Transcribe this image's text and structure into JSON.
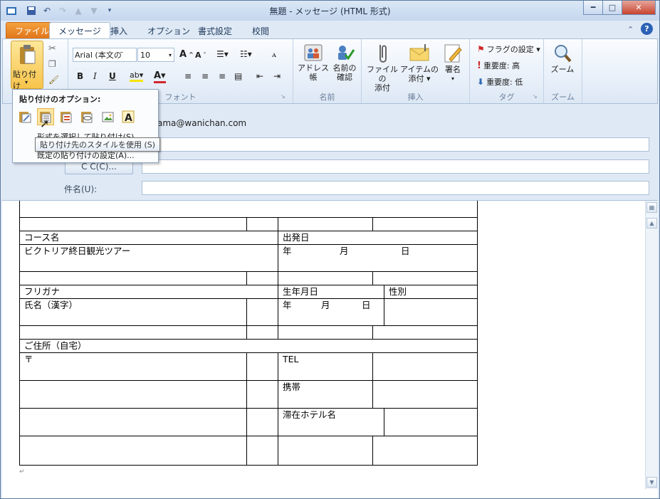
{
  "window": {
    "title": "無題 - メッセージ (HTML 形式)"
  },
  "tabs": [
    "ファイル",
    "メッセージ",
    "挿入",
    "オプション",
    "書式設定",
    "校閲"
  ],
  "ribbon": {
    "paste_label": "貼り付け",
    "font_name": "Arial (本文の̄",
    "font_size": "10",
    "font_group": "フォント",
    "names_group": "名前",
    "address_book": "アドレス帳",
    "check_names_1": "名前の",
    "check_names_2": "確認",
    "attach_file_1": "ファイルの",
    "attach_file_2": "添付",
    "attach_item_1": "アイテムの",
    "attach_item_2": "添付 ▾",
    "signature": "署名",
    "insert_group": "挿入",
    "flag": "フラグの設定 ▾",
    "importance_high": "重要度: 高",
    "importance_low": "重要度: 低",
    "tags_group": "タグ",
    "zoom": "ズーム",
    "zoom_group": "ズーム"
  },
  "header": {
    "to_value": "ama@wanichan.com",
    "cc_button": "C C(C)...",
    "subject_label": "件名(U):"
  },
  "paste_popup": {
    "title": "貼り付けのオプション:",
    "menu1": "形式を選択して貼り付け(S)...",
    "menu2": "既定の貼り付けの設定(A)...",
    "tooltip": "貼り付け先のスタイルを使用 (S)"
  },
  "table": {
    "course_name": "コース名",
    "departure_date": "出発日",
    "course_value": "ビクトリア終日観光ツアー",
    "dep_year": "年",
    "dep_month": "月",
    "dep_day": "日",
    "furigana": "フリガナ",
    "birthdate": "生年月日",
    "gender": "性別",
    "name_kanji": "氏名（漢字）",
    "b_year": "年",
    "b_month": "月",
    "b_day": "日",
    "address": "ご住所（自宅）",
    "postal": "〒",
    "tel": "TEL",
    "mobile": "携帯",
    "hotel": "滞在ホテル名"
  },
  "colors": {
    "accent": "#e0741a",
    "ribbon_bg": "#dde8f5"
  }
}
